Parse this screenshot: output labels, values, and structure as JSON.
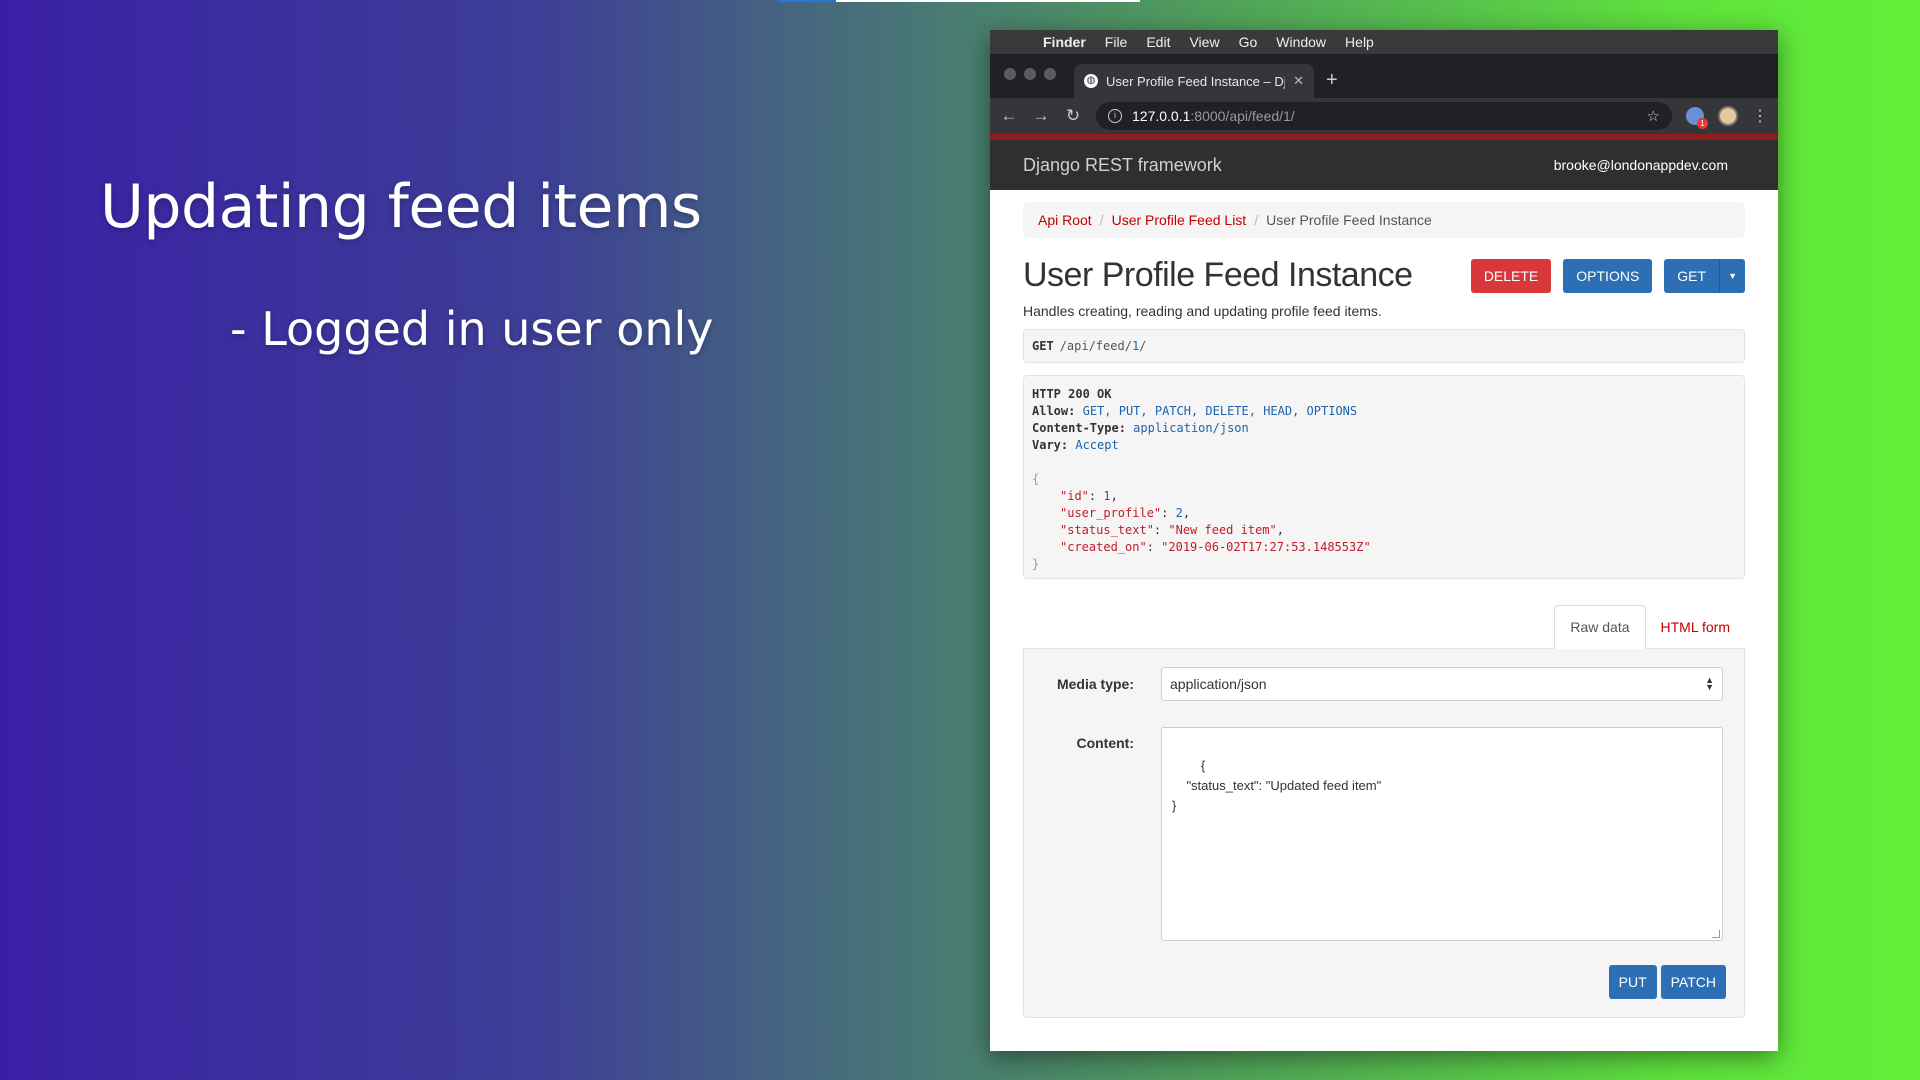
{
  "slide": {
    "title": "Updating feed items",
    "bullet": "- Logged in user only",
    "progress_fraction": 0.16
  },
  "menubar": {
    "items": [
      "Finder",
      "File",
      "Edit",
      "View",
      "Go",
      "Window",
      "Help"
    ]
  },
  "browser": {
    "tab_title": "User Profile Feed Instance – Dj",
    "url_host": "127.0.0.1",
    "url_rest": ":8000/api/feed/1/",
    "extension_badge": "1"
  },
  "drf": {
    "brand": "Django REST framework",
    "user": "brooke@londonappdev.com",
    "breadcrumbs": [
      "Api Root",
      "User Profile Feed List",
      "User Profile Feed Instance"
    ],
    "page_title": "User Profile Feed Instance",
    "buttons": {
      "delete": "DELETE",
      "options": "OPTIONS",
      "get": "GET"
    },
    "description": "Handles creating, reading and updating profile feed items.",
    "request": {
      "method": "GET",
      "path_prefix": "/api/feed/",
      "path_id": "1",
      "path_suffix": "/"
    },
    "response": {
      "status": "HTTP 200 OK",
      "allow_label": "Allow:",
      "allow_value": "GET, PUT, PATCH, DELETE, HEAD, OPTIONS",
      "content_type_label": "Content-Type:",
      "content_type_value": "application/json",
      "vary_label": "Vary:",
      "vary_value": "Accept",
      "open_brace": "{",
      "close_brace": "}",
      "id_key": "\"id\"",
      "id_value": "1",
      "user_profile_key": "\"user_profile\"",
      "user_profile_value": "2",
      "status_text_key": "\"status_text\"",
      "status_text_value": "\"New feed item\"",
      "created_on_key": "\"created_on\"",
      "created_on_value": "\"2019-06-02T17:27:53.148553Z\""
    },
    "form_tabs": {
      "raw": "Raw data",
      "html": "HTML form"
    },
    "form": {
      "media_type_label": "Media type:",
      "media_type_value": "application/json",
      "content_label": "Content:",
      "content_value": "{\n    \"status_text\": \"Updated feed item\"\n}",
      "put": "PUT",
      "patch": "PATCH"
    }
  },
  "colors": {
    "link_red": "#c20000",
    "danger": "#d9383a",
    "primary": "#2c6fb5"
  }
}
